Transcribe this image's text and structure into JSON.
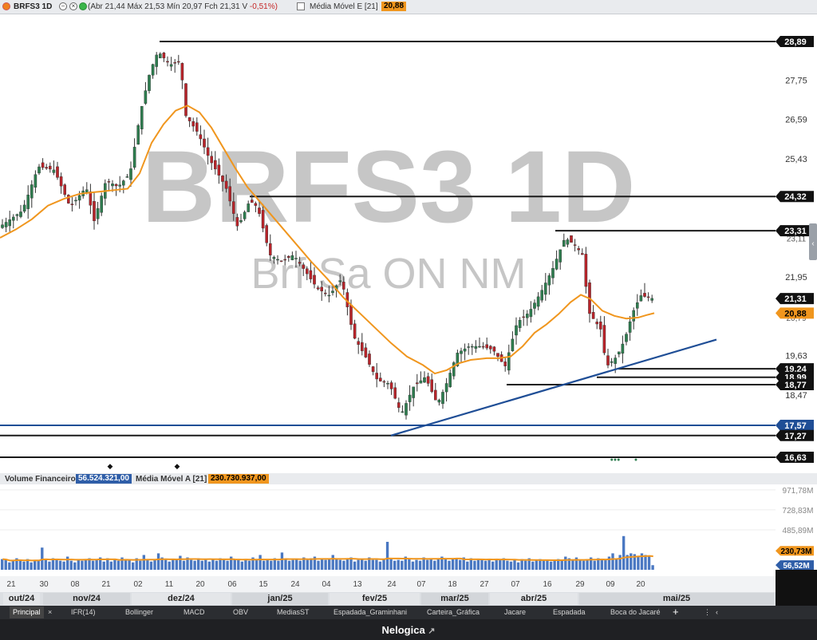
{
  "header": {
    "ticker": "BRFS3 1D",
    "ohlc_text": "(Abr 21,44 Máx 21,53 Mín 20,97 Fch 21,31 V",
    "change_text": "-0,51%)",
    "ma_label": "Média Móvel E [21]",
    "ma_value": "20,88"
  },
  "watermark": {
    "main": "BRFS3 1D",
    "sub": "Brf Sa ON NM"
  },
  "colors": {
    "up": "#2e7d4f",
    "down": "#b8242a",
    "ma": "#f0961e",
    "trend": "#1f4e96",
    "support": "#1a1a1a",
    "line_1757": "#1f4e96",
    "volume": "#4a78c2"
  },
  "price_axis": {
    "ticks": [
      "27,75",
      "26,59",
      "25,43",
      "21,95",
      "19,63",
      "18,47"
    ],
    "scale_min": 16.2,
    "scale_max": 29.4
  },
  "price_labels": [
    {
      "text": "28,89",
      "value": 28.89,
      "style": "dark"
    },
    {
      "text": "24,32",
      "value": 24.32,
      "style": "dark"
    },
    {
      "text": "23,31",
      "value": 23.31,
      "style": "dark"
    },
    {
      "text": "21,31",
      "value": 21.31,
      "style": "dark"
    },
    {
      "text": "20,88",
      "value": 20.88,
      "style": "orange"
    },
    {
      "text": "19,24",
      "value": 19.24,
      "style": "dark"
    },
    {
      "text": "18,99",
      "value": 18.99,
      "style": "dark"
    },
    {
      "text": "18,77",
      "value": 18.77,
      "style": "dark"
    },
    {
      "text": "17,57",
      "value": 17.57,
      "style": "blue"
    },
    {
      "text": "17,27",
      "value": 17.27,
      "style": "dark"
    },
    {
      "text": "16,63",
      "value": 16.63,
      "style": "dark"
    }
  ],
  "overlap_tick": "23,11",
  "overlap_tick2": "20,79",
  "volume_panel": {
    "label": "Volume Financeiro",
    "value": "56.524.321,00",
    "ma_label": "Média Móvel A [21]",
    "ma_value": "230.730.937,00",
    "ticks": [
      "971,78M",
      "728,83M",
      "485,89M"
    ],
    "ma_badge": "230,73M",
    "vol_badge": "56,52M",
    "max_value_m": 1000
  },
  "time_axis": {
    "days": [
      "21",
      "30",
      "08",
      "21",
      "02",
      "11",
      "20",
      "06",
      "15",
      "24",
      "04",
      "13",
      "24",
      "07",
      "18",
      "27",
      "07",
      "16",
      "29",
      "09",
      "20"
    ],
    "months": [
      "out/24",
      "nov/24",
      "dez/24",
      "jan/25",
      "fev/25",
      "mar/25",
      "abr/25",
      "mai/25"
    ]
  },
  "tabs": [
    "Principal",
    "IFR(14)",
    "Bollinger",
    "MACD",
    "OBV",
    "MediasST",
    "Espadada_Graminhani",
    "Carteira_Gráfica",
    "Jacare",
    "Espadada",
    "Boca do Jacaré",
    "+"
  ],
  "tab_close": "×",
  "footer": {
    "brand": "Nelogica"
  },
  "chart_data": {
    "type": "candlestick",
    "title": "BRFS3 1D",
    "series": [
      {
        "name": "Média Móvel E [21]",
        "kind": "line",
        "values": [
          [
            0,
            23.1
          ],
          [
            20,
            23.35
          ],
          [
            40,
            23.65
          ],
          [
            60,
            24.05
          ],
          [
            80,
            24.25
          ],
          [
            100,
            24.4
          ],
          [
            120,
            24.45
          ],
          [
            140,
            24.5
          ],
          [
            160,
            24.55
          ],
          [
            175,
            25.0
          ],
          [
            190,
            25.9
          ],
          [
            205,
            26.45
          ],
          [
            220,
            26.85
          ],
          [
            235,
            27.0
          ],
          [
            250,
            26.8
          ],
          [
            265,
            26.35
          ],
          [
            280,
            25.75
          ],
          [
            295,
            25.15
          ],
          [
            310,
            24.6
          ],
          [
            330,
            24.05
          ],
          [
            350,
            23.5
          ],
          [
            370,
            22.95
          ],
          [
            390,
            22.4
          ],
          [
            410,
            21.9
          ],
          [
            430,
            21.35
          ],
          [
            450,
            20.9
          ],
          [
            470,
            20.45
          ],
          [
            490,
            20.0
          ],
          [
            510,
            19.6
          ],
          [
            530,
            19.35
          ],
          [
            545,
            19.1
          ],
          [
            560,
            19.2
          ],
          [
            575,
            19.4
          ],
          [
            590,
            19.5
          ],
          [
            610,
            19.55
          ],
          [
            625,
            19.55
          ],
          [
            640,
            19.6
          ],
          [
            655,
            19.9
          ],
          [
            670,
            20.3
          ],
          [
            685,
            20.55
          ],
          [
            700,
            20.85
          ],
          [
            715,
            21.2
          ],
          [
            728,
            21.42
          ],
          [
            740,
            21.3
          ],
          [
            755,
            20.95
          ],
          [
            770,
            20.8
          ],
          [
            785,
            20.72
          ],
          [
            800,
            20.75
          ],
          [
            810,
            20.82
          ],
          [
            820,
            20.88
          ]
        ]
      },
      {
        "name": "Linha de tendência",
        "kind": "trend",
        "start": [
          490,
          17.27
        ],
        "end": [
          898,
          20.1
        ]
      },
      {
        "name": "Volume Financeiro",
        "kind": "bar",
        "values": [
          130,
          120,
          90,
          110,
          140,
          110,
          100,
          130,
          90,
          120,
          110,
          270,
          130,
          100,
          140,
          120,
          110,
          100,
          160,
          110,
          90,
          130,
          110,
          120,
          140,
          110,
          130,
          150,
          100,
          140,
          100,
          120,
          110,
          150,
          130,
          120,
          90,
          140,
          110,
          180,
          120,
          100,
          120,
          200,
          150,
          120,
          100,
          130,
          120,
          170,
          110,
          150,
          120,
          110,
          140,
          110,
          120,
          100,
          130,
          110,
          140,
          120,
          110,
          160,
          130,
          120,
          100,
          120,
          110,
          150,
          130,
          180,
          110,
          120,
          110,
          140,
          110,
          210,
          130,
          110,
          120,
          130,
          110,
          150,
          120,
          140,
          160,
          110,
          130,
          120,
          140,
          180,
          130,
          120,
          110,
          140,
          150,
          100,
          120,
          130,
          110,
          150,
          120,
          120,
          100,
          130,
          340,
          130,
          110,
          120,
          110,
          160,
          130,
          100,
          120,
          110,
          150,
          120,
          130,
          110,
          140,
          160,
          130,
          110,
          130,
          140,
          120,
          150,
          100,
          140,
          110,
          120,
          130,
          110,
          120,
          100,
          130,
          120,
          140,
          110,
          100,
          120,
          90,
          130,
          110,
          140,
          100,
          120,
          130,
          110,
          120,
          100,
          120,
          130,
          110,
          160,
          140,
          120,
          150,
          120,
          110,
          130,
          150,
          110,
          140,
          130,
          120,
          160,
          200,
          140,
          180,
          410,
          180,
          200,
          190,
          170,
          200,
          180,
          160,
          56
        ]
      }
    ],
    "ylabel": "",
    "xlabel": ""
  }
}
